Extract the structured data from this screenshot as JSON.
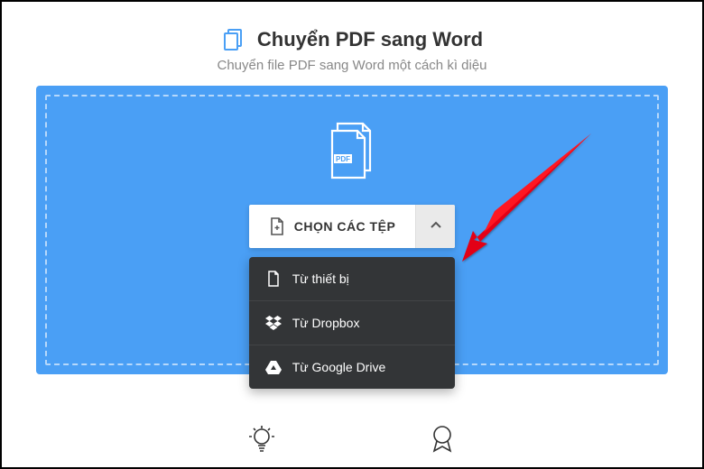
{
  "header": {
    "title": "Chuyển PDF sang Word",
    "subtitle": "Chuyển file PDF sang Word một cách kì diệu"
  },
  "picker": {
    "button_label": "CHỌN CÁC TỆP",
    "options": [
      {
        "icon": "file",
        "label": "Từ thiết bị"
      },
      {
        "icon": "dropbox",
        "label": "Từ Dropbox"
      },
      {
        "icon": "gdrive",
        "label": "Từ Google Drive"
      }
    ]
  },
  "colors": {
    "accent": "#4a9ff5",
    "dropdown_bg": "#333537"
  }
}
